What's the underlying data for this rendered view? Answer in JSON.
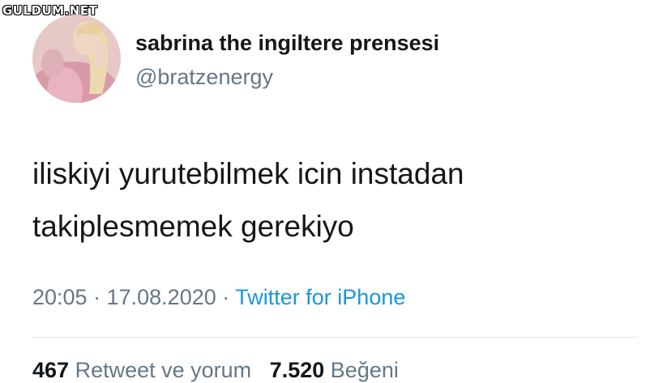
{
  "watermark": "GULDUM.NET",
  "user": {
    "display_name": "sabrina the ingiltere prensesi",
    "handle": "@bratzenergy"
  },
  "tweet": {
    "lines": [
      "iliskiyi yurutebilmek icin instadan",
      "takiplesmemek gerekiyo"
    ]
  },
  "meta": {
    "time": "20:05",
    "separator": "·",
    "date": "17.08.2020",
    "source": "Twitter for iPhone"
  },
  "stats": {
    "retweets_count": "467",
    "retweets_label": "Retweet ve yorum",
    "likes_count": "7.520",
    "likes_label": "Beğeni"
  },
  "colors": {
    "text": "#14171a",
    "secondary": "#657786",
    "link": "#1b95e0",
    "divider": "#e1e8ed"
  }
}
